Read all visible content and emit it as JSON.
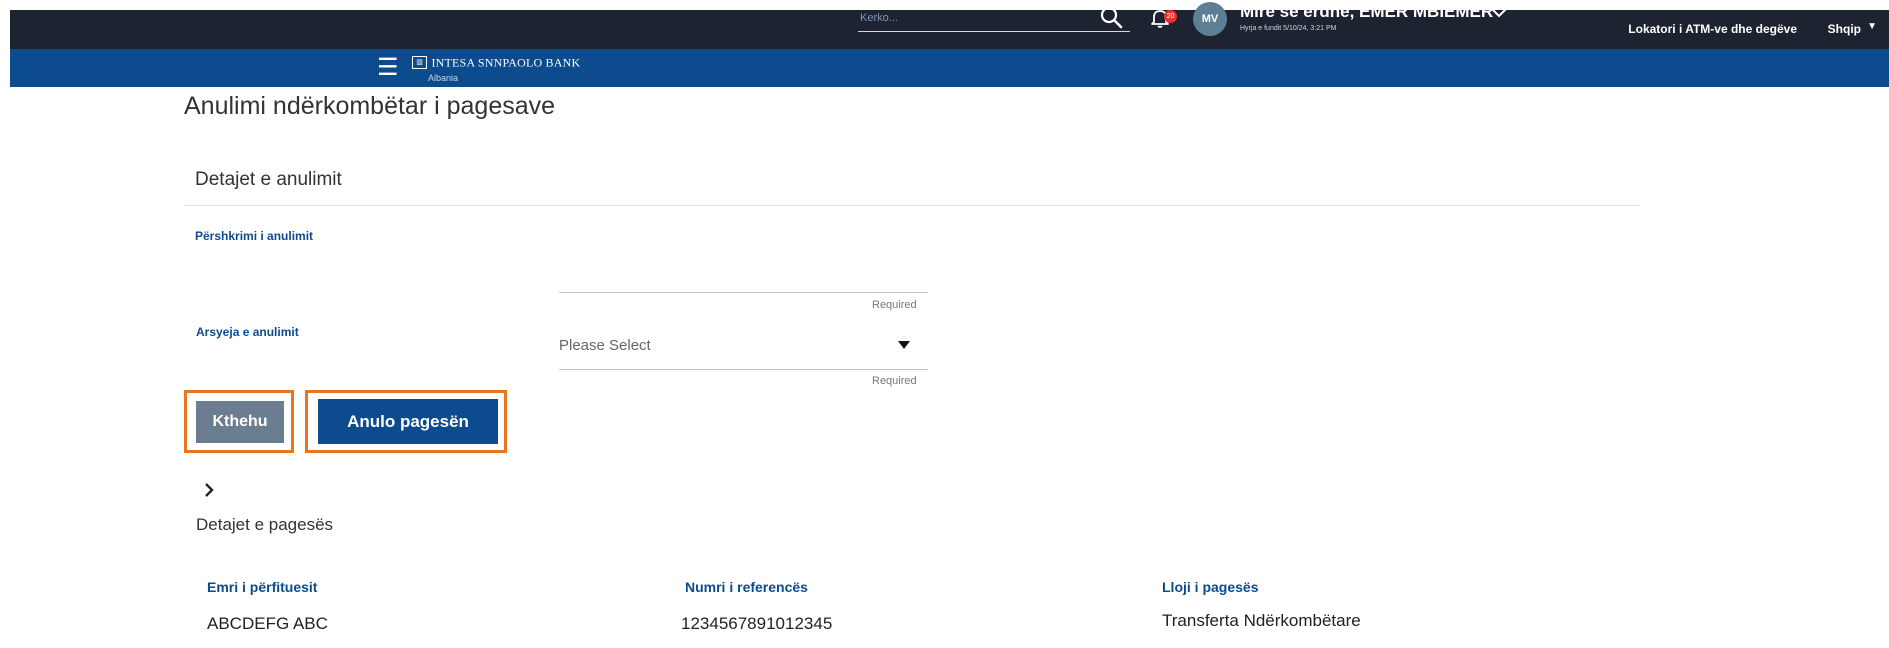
{
  "topbar": {
    "atm_link": "Lokatori i ATM-ve dhe degëve",
    "language": "Shqip"
  },
  "navbar": {
    "logo_name": "INTESA SNNPAOLO BANK",
    "logo_sub": "Albania",
    "search_placeholder": "Kerko...",
    "notification_count": "20",
    "avatar_initials": "MV",
    "welcome": "Mirë se erdhe, EMER MBIEMER",
    "last_login": "Hyrja e fundit 5/10/24, 3:21 PM"
  },
  "page": {
    "title": "Anulimi ndërkombëtar i pagesave"
  },
  "cancel_details": {
    "section_title": "Detajet e anulimit",
    "description_label": "Përshkrimi i anulimit",
    "description_value": "",
    "description_required": "Required",
    "reason_label": "Arsyeja e anulimit",
    "reason_value": "Please Select",
    "reason_required": "Required"
  },
  "actions": {
    "back_label": "Kthehu",
    "cancel_label": "Anulo pagesën"
  },
  "payment_details": {
    "title": "Detajet e pagesës",
    "columns": [
      {
        "label": "Emri i përfituesit",
        "value": "ABCDEFG ABC"
      },
      {
        "label": "Numri i referencës",
        "value": "1234567891012345"
      },
      {
        "label": "Lloji i pagesës",
        "value": "Transferta Ndërkombëtare"
      }
    ]
  },
  "colors": {
    "primary": "#0c4b8e",
    "topbar": "#1e2331",
    "highlight": "#e8761f",
    "back_button": "#6b7d91"
  },
  "icons": [
    "hamburger-icon",
    "search-icon",
    "bell-icon",
    "chevron-down-icon",
    "caret-down-icon",
    "chevron-right-icon"
  ]
}
